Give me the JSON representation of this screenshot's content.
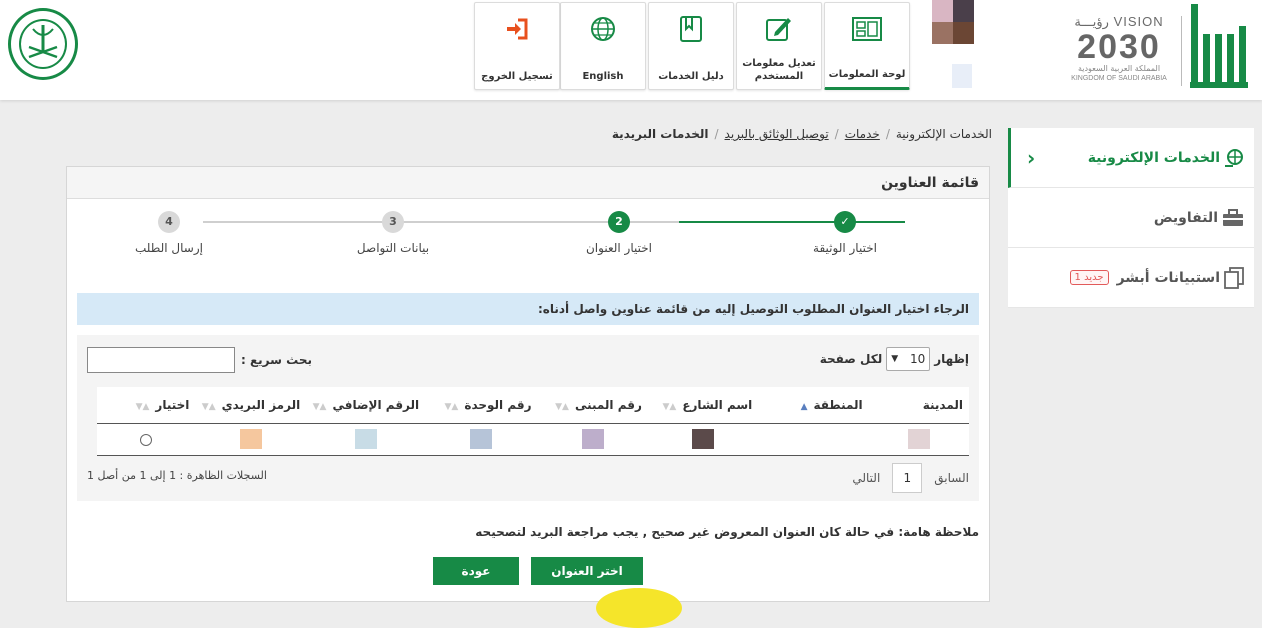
{
  "colors": {
    "brand": "#178a46",
    "alert_bg": "#d6e9f7",
    "badge": "#e25a5a",
    "logout_icon": "#e8501e"
  },
  "header": {
    "vision": {
      "word": "VISION",
      "year": "2030",
      "arabic_word": "رؤيـــة",
      "kingdom_ar": "المملكة العربية السعودية",
      "kingdom_en": "KINGDOM OF SAUDI ARABIA"
    },
    "nav": [
      {
        "label": "لوحة المعلومات",
        "icon": "dashboard-icon"
      },
      {
        "label": "تعديل معلومات المستخدم",
        "icon": "edit-icon"
      },
      {
        "label": "دليل الخدمات",
        "icon": "book-icon"
      },
      {
        "label": "English",
        "icon": "globe-icon"
      },
      {
        "label": "تسجيل الخروج",
        "icon": "logout-icon"
      }
    ]
  },
  "sidebar": {
    "items": [
      {
        "label": "الخدمات الإلكترونية",
        "icon": "globe-hand-icon"
      },
      {
        "label": "التفاويض",
        "icon": "briefcase-icon"
      },
      {
        "label": "استبيانات أبشر",
        "icon": "documents-icon",
        "badge": "جديد 1"
      }
    ]
  },
  "breadcrumb": {
    "home": "الخدمات الإلكترونية",
    "l1": "خدمات",
    "l2": "توصيل الوثائق بالبريد",
    "current": "الخدمات البريدية"
  },
  "panel": {
    "title": "قائمة العناوين",
    "steps": [
      {
        "number": "✓",
        "label": "اختيار الوثيقة",
        "state": "done"
      },
      {
        "number": "2",
        "label": "اختيار العنوان",
        "state": "current"
      },
      {
        "number": "3",
        "label": "بيانات التواصل",
        "state": "todo"
      },
      {
        "number": "4",
        "label": "إرسال الطلب",
        "state": "todo"
      }
    ],
    "alert": "الرجاء اختيار العنوان المطلوب التوصيل إليه من قائمة عناوين واصل أدناه:",
    "table": {
      "show_label": "إظهار",
      "per_page_value": "10",
      "per_page_label": "لكل صفحة",
      "search_label": "بحث سريع :",
      "search_value": "",
      "columns": [
        "المدينة",
        "المنطقة",
        "اسم الشارع",
        "رقم المبنى",
        "رقم الوحدة",
        "الرقم الإضافي",
        "الرمز البريدي",
        "اختيار"
      ],
      "row_swatches": [
        "#e2d3d5",
        "",
        "#5b4a4a",
        "#bdaecb",
        "#b6c4d8",
        "#c8dce6",
        "#f5c79e",
        ""
      ],
      "info": "السجلات الظاهرة : 1 إلى 1 من أصل 1",
      "prev": "السابق",
      "page": "1",
      "next": "التالي"
    },
    "note": "ملاحظة هامة: في حالة كان العنوان المعروض غير صحيح , يجب مراجعة البريد لتصحيحه",
    "buttons": {
      "select": "اختر العنوان",
      "back": "عودة"
    }
  }
}
